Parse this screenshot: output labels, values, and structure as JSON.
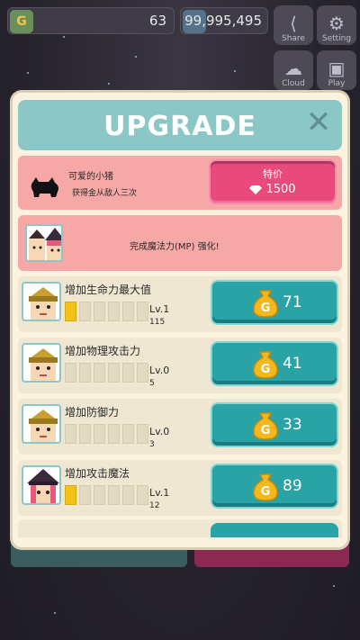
{
  "hud": {
    "gold_symbol": "G",
    "gold_value": "63",
    "gem_value": "99,995,495",
    "share_label": "Share",
    "setting_label": "Setting",
    "cloud_label": "Cloud",
    "play_label": "Play"
  },
  "modal": {
    "title": "UPGRADE",
    "close_symbol": "✕"
  },
  "pet": {
    "name": "可爱的小猪",
    "desc": "获得金从敌人三次",
    "special_label": "特价",
    "special_price": "1500"
  },
  "mp_notice": "完成魔法力(MP) 强化!",
  "upgrades": [
    {
      "name": "增加生命力最大值",
      "level": "Lv.1",
      "count": "115",
      "price": "71",
      "filled": 1
    },
    {
      "name": "增加物理攻击力",
      "level": "Lv.0",
      "count": "5",
      "price": "41",
      "filled": 0
    },
    {
      "name": "增加防御力",
      "level": "Lv.0",
      "count": "3",
      "price": "33",
      "filled": 0
    },
    {
      "name": "增加攻击魔法",
      "level": "Lv.1",
      "count": "12",
      "price": "89",
      "filled": 1
    }
  ],
  "colors": {
    "header": "#8cc7c8",
    "pink_row": "#f6a8a6",
    "special_button": "#e84a7c",
    "buy_button": "#2aa3a6",
    "level_fill": "#f2c219"
  }
}
